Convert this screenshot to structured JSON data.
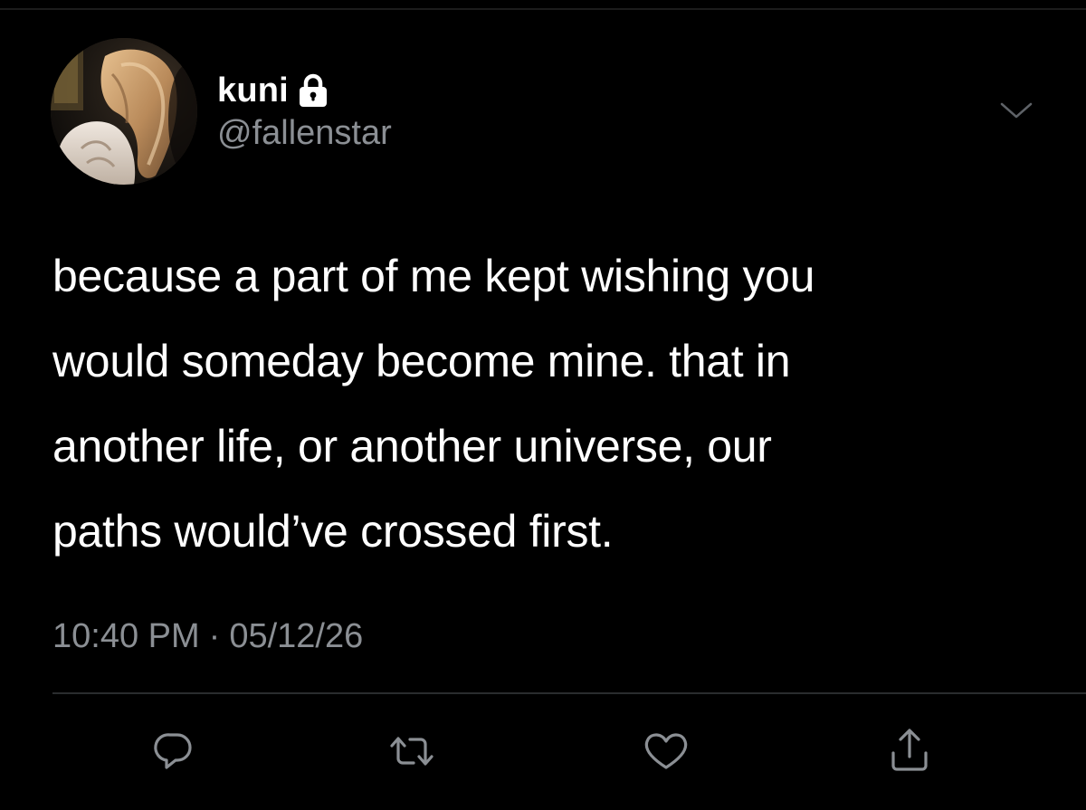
{
  "colors": {
    "background": "#000000",
    "primary_text": "#ffffff",
    "secondary_text": "#8b8f94",
    "icon": "#8b8f94",
    "divider": "#2a2c2e"
  },
  "author": {
    "display_name": "kuni",
    "handle": "@fallenstar",
    "protected_icon": "lock-icon",
    "avatar": "profile-photo"
  },
  "tweet": {
    "lines": [
      "because a part of me kept wishing you",
      "would someday become mine. that in",
      "another life, or another universe, our",
      "paths would’ve crossed first."
    ],
    "time": "10:40 PM",
    "separator": "·",
    "date": "05/12/26"
  },
  "menu": {
    "icon": "chevron-down-icon"
  },
  "actions": [
    {
      "name": "reply",
      "icon": "reply-icon"
    },
    {
      "name": "retweet",
      "icon": "retweet-icon"
    },
    {
      "name": "like",
      "icon": "heart-icon"
    },
    {
      "name": "share",
      "icon": "share-icon"
    }
  ]
}
